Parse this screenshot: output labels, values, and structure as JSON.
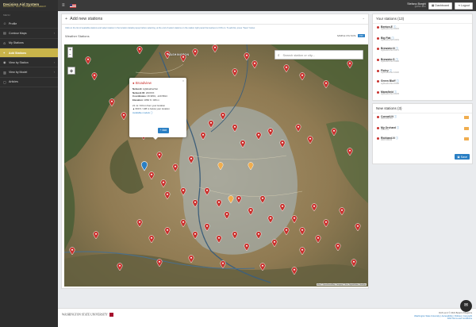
{
  "topbar": {
    "brand_name": "Decision Aid System",
    "brand_tagline": "IRRIGATION · PEST · NUTRIENT MANAGEMENT",
    "menu_icon": "hamburger-icon",
    "user_name": "Stefano Borghi",
    "user_email": "@WSU.EDU",
    "dashboard_label": "Dashboard",
    "logout_label": "Logout"
  },
  "sidebar": {
    "header": "MENU",
    "items": [
      {
        "label": "Profile",
        "icon": "user-icon",
        "active": false,
        "chevron": false
      },
      {
        "label": "Contour Maps",
        "icon": "map-icon",
        "active": false,
        "chevron": true
      },
      {
        "label": "My Stations",
        "icon": "pin-icon",
        "active": false,
        "chevron": false
      },
      {
        "label": "Add Stations",
        "icon": "plus-icon",
        "active": true,
        "chevron": false
      },
      {
        "label": "View by Station",
        "icon": "eye-icon",
        "active": false,
        "chevron": true
      },
      {
        "label": "View by Model",
        "icon": "chart-icon",
        "active": false,
        "chevron": true
      },
      {
        "label": "Articles",
        "icon": "doc-icon",
        "active": false,
        "chevron": false
      }
    ]
  },
  "main": {
    "title": "Add new stations",
    "hint": "Click on the list of available stations and select station in the location details popup before selecting, at the end of select stations on the station right panel themselves to CSS on. To add list, press \"Save\" below.",
    "map_title": "Weather Stations",
    "csv_label": "SAMPLE CSV DATA",
    "csv_button": "CSV",
    "search_placeholder": "Search station or city...",
    "map_region_label": "WASHINGTON",
    "attribution": "Map © OpenStreetMap · Imagery © Esri, DigitalGlobe, GeoEye"
  },
  "popup": {
    "title": "Broadview",
    "network_label": "Network:",
    "network_value": "AgWeatherNet",
    "network_id_label": "Network ID:",
    "network_id_value": "200XXX",
    "coordinates_label": "Coordinates:",
    "coordinates_value": "46.9801, -120.5814",
    "elevation_label": "Elevation:",
    "elevation_value": "1860 ft / 466 m",
    "distance": "21 mi / 33 km from your location",
    "elevation_diff": "▲ 600 ft / 138 m below your location",
    "models_link": "Available models ⓘ",
    "add_label": "Add"
  },
  "your_stations": {
    "title": "Your stations (13)",
    "items": [
      {
        "name": "Benton.E",
        "sub": "AgWeatherNet 10015"
      },
      {
        "name": "Big Flat",
        "sub": "AgWeatherNet 10019"
      },
      {
        "name": "Brewster.N",
        "sub": "AgWeatherNet 10071"
      },
      {
        "name": "Brewster.S",
        "sub": "AgWeatherNet 10026"
      },
      {
        "name": "Finley",
        "sub": "AgWeatherNet 10020"
      },
      {
        "name": "Green Bluff",
        "sub": "AgWeatherNet 20096"
      },
      {
        "name": "Mansfield",
        "sub": "AgWeatherNet 10105"
      }
    ]
  },
  "new_stations": {
    "title": "New stations (3)",
    "items": [
      {
        "name": "Connell.N",
        "sub": "AWN 200XXX"
      },
      {
        "name": "My Orchard",
        "sub": "VIRTUAL"
      },
      {
        "name": "Richland.N",
        "sub": "AWN 330100"
      }
    ],
    "save_label": "Save"
  },
  "footer": {
    "university": "WASHINGTON STATE UNIVERSITY",
    "copyright": "DAS ver.2 © 2021 Board of Regents",
    "line2": "Washington State University | Accessibility | Policies | Copyright",
    "line3": "DAS Terms and Conditions"
  },
  "colors": {
    "accent": "#c9b44a",
    "marker": "#c9302c",
    "primary": "#2a7fc4",
    "sidebar": "#2d2d2d"
  }
}
